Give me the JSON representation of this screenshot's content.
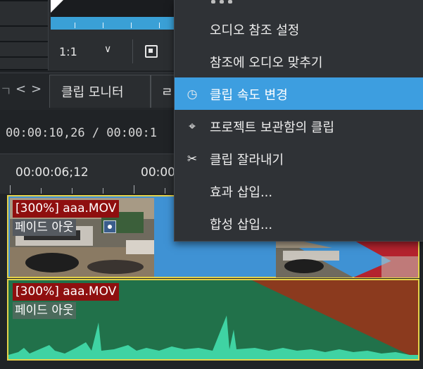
{
  "monitor": {
    "zoom_value": "1:1",
    "zoom_chevron_glyph": "∨",
    "frame_icon": "frame-icon"
  },
  "tabs": {
    "partial_left": "ㄱ",
    "scroll_left": "<",
    "scroll_right": ">",
    "clip_monitor": "클립 모니터",
    "next_partial": "ㄹ"
  },
  "timeline": {
    "timecode": "00:00:10,26 / 00:00:1",
    "ruler_labels": [
      "00:00:06;12",
      "00:00:"
    ]
  },
  "video_track": {
    "clip_name": "[300%] aaa.MOV",
    "effect_label": "페이드 아웃",
    "clip_color": "#3f92d4",
    "border_color": "#e5d24a"
  },
  "audio_track": {
    "clip_name": "[300%] aaa.MOV",
    "effect_label": "페이드 아웃",
    "clip_color": "#21714a",
    "fade_color": "#8b3a1e",
    "waveform_color": "#3fd3a3"
  },
  "context_menu": {
    "items": [
      {
        "label": "오디오 참조 설정",
        "icon": ""
      },
      {
        "label": "참조에 오디오 맞추기",
        "icon": ""
      },
      {
        "label": "클립 속도 변경",
        "icon": "speedometer-icon",
        "glyph": "◷",
        "active": true
      },
      {
        "label": "프로젝트 보관함의 클립",
        "icon": "pin-icon",
        "glyph": "⌖"
      },
      {
        "label": "클립 잘라내기",
        "icon": "scissors-icon",
        "glyph": "✂"
      },
      {
        "label": "효과 삽입...",
        "icon": ""
      },
      {
        "label": "합성 삽입...",
        "icon": ""
      }
    ],
    "highlight_color": "#3d9ee0"
  }
}
